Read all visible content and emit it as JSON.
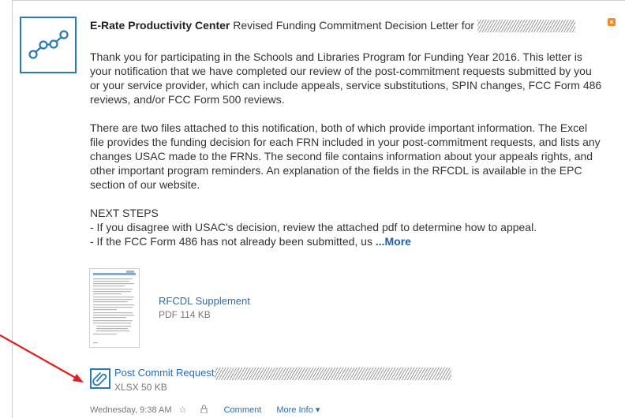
{
  "header": {
    "sender": "E-Rate Productivity Center",
    "subject": "Revised Funding Commitment Decision Letter for"
  },
  "body": {
    "paragraph1": "Thank you for participating in the Schools and Libraries Program for Funding Year 2016. This letter is your notification that we have completed our review of the post-commitment requests submitted by you or your service provider, which can include appeals, service substitutions, SPIN changes, FCC Form 486 reviews, and/or FCC Form 500 reviews.",
    "paragraph2": "There are two files attached to this notification, both of which provide important information. The Excel file provides the funding decision for each FRN included in your post-commitment requests, and lists any changes USAC made to the FRNs. The second file contains information about your appeals rights, and other important program reminders. An explanation of the fields in the RFCDL is available in the EPC section of our website.",
    "next_steps_heading": "NEXT STEPS",
    "next_step1": "- If you disagree with USAC's decision, review the attached pdf to determine how to appeal.",
    "next_step2": "- If the FCC Form 486 has not already been submitted, us",
    "more_label": "...More"
  },
  "attachments": [
    {
      "name": "RFCDL Supplement",
      "meta": "PDF 114 KB",
      "icon": "pdf-thumbnail"
    },
    {
      "name": "Post Commit Request",
      "meta": "XLSX 50 KB",
      "icon": "paperclip-icon"
    }
  ],
  "footer": {
    "timestamp": "Wednesday, 9:38 AM",
    "comment_label": "Comment",
    "more_info_label": "More Info ▾"
  },
  "colors": {
    "accent": "#2a7ab8",
    "link": "#2a6bb3",
    "close": "#f08a24",
    "arrow": "#e0201c"
  }
}
